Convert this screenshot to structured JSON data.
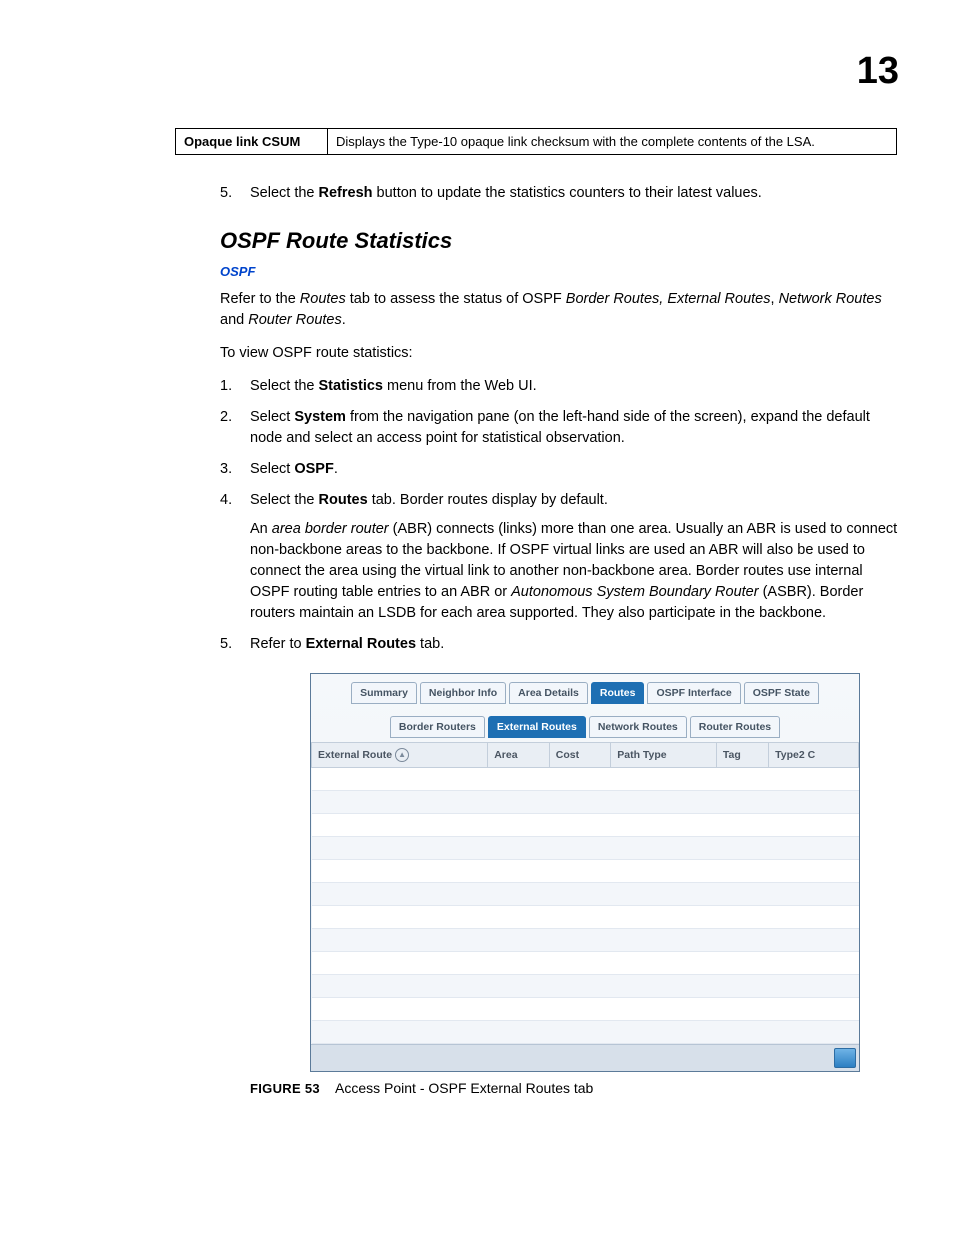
{
  "page_number": "13",
  "def_row": {
    "label": "Opaque link CSUM",
    "desc": "Displays the Type-10 opaque link checksum with the complete contents of the LSA."
  },
  "prev_step": {
    "num": "5.",
    "pre": "Select the ",
    "bold": "Refresh",
    "post": " button to update the statistics counters to their latest values."
  },
  "section_title": "OSPF Route Statistics",
  "ospf_link": "OSPF",
  "intro_para": {
    "p1a": "Refer to the ",
    "p1_i1": "Routes",
    "p1b": " tab to assess the status of OSPF ",
    "p1_i2": "Border Routes, External Routes",
    "p1c": ", ",
    "p1_i3": "Network Routes",
    "p1d": " and ",
    "p1_i4": "Router Routes",
    "p1e": "."
  },
  "view_line": "To view OSPF route statistics:",
  "steps": {
    "s1": {
      "num": "1.",
      "a": "Select the ",
      "b": "Statistics",
      "c": " menu from the Web UI."
    },
    "s2": {
      "num": "2.",
      "a": "Select ",
      "b": "System",
      "c": " from the navigation pane (on the left-hand side of the screen), expand the default node and select an access point for statistical observation."
    },
    "s3": {
      "num": "3.",
      "a": "Select ",
      "b": "OSPF",
      "c": "."
    },
    "s4": {
      "num": "4.",
      "a": "Select the ",
      "b": "Routes",
      "c": " tab. Border routes display by default.",
      "body_a": "An ",
      "body_i1": "area border router",
      "body_b": " (ABR) connects (links) more than one area. Usually an ABR is used to connect non-backbone areas to the backbone. If OSPF virtual links are used an ABR will also be used to connect the area using the virtual link to another non-backbone area. Border routes use internal OSPF routing table entries to an ABR or ",
      "body_i2": "Autonomous System Boundary Router",
      "body_c": " (ASBR). Border routers maintain an LSDB for each area supported. They also participate in the backbone."
    },
    "s5": {
      "num": "5.",
      "a": "Refer to ",
      "b": "External Routes",
      "c": " tab."
    }
  },
  "fig": {
    "tabs": [
      "Summary",
      "Neighbor Info",
      "Area Details",
      "Routes",
      "OSPF Interface",
      "OSPF State"
    ],
    "active_tab": "Routes",
    "subtabs": [
      "Border Routers",
      "External Routes",
      "Network Routes",
      "Router Routes"
    ],
    "active_subtab": "External Routes",
    "columns": [
      "External Route",
      "Area",
      "Cost",
      "Path Type",
      "Tag",
      "Type2 C"
    ]
  },
  "caption": {
    "label": "Figure 53",
    "text": "Access Point - OSPF External Routes tab"
  }
}
